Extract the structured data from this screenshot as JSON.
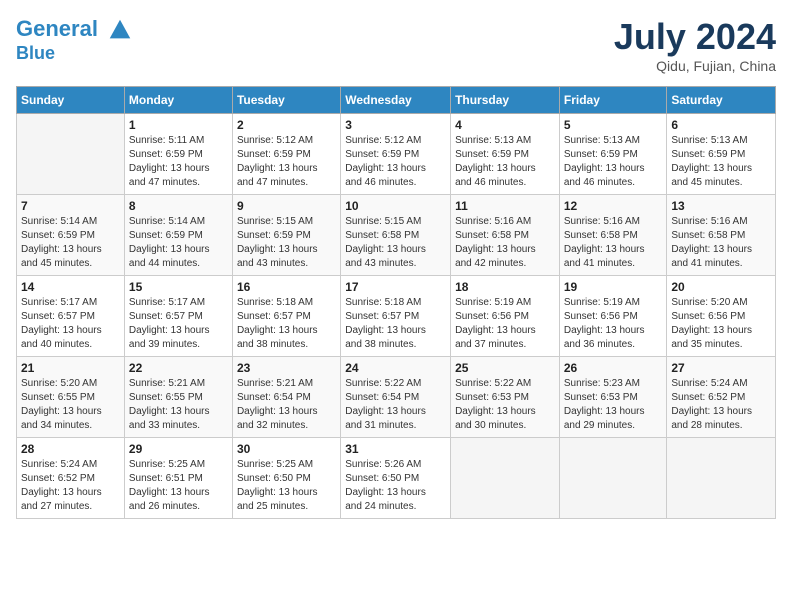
{
  "header": {
    "logo_line1": "General",
    "logo_line2": "Blue",
    "month_title": "July 2024",
    "subtitle": "Qidu, Fujian, China"
  },
  "days_of_week": [
    "Sunday",
    "Monday",
    "Tuesday",
    "Wednesday",
    "Thursday",
    "Friday",
    "Saturday"
  ],
  "weeks": [
    [
      {
        "day": "",
        "info": ""
      },
      {
        "day": "1",
        "info": "Sunrise: 5:11 AM\nSunset: 6:59 PM\nDaylight: 13 hours\nand 47 minutes."
      },
      {
        "day": "2",
        "info": "Sunrise: 5:12 AM\nSunset: 6:59 PM\nDaylight: 13 hours\nand 47 minutes."
      },
      {
        "day": "3",
        "info": "Sunrise: 5:12 AM\nSunset: 6:59 PM\nDaylight: 13 hours\nand 46 minutes."
      },
      {
        "day": "4",
        "info": "Sunrise: 5:13 AM\nSunset: 6:59 PM\nDaylight: 13 hours\nand 46 minutes."
      },
      {
        "day": "5",
        "info": "Sunrise: 5:13 AM\nSunset: 6:59 PM\nDaylight: 13 hours\nand 46 minutes."
      },
      {
        "day": "6",
        "info": "Sunrise: 5:13 AM\nSunset: 6:59 PM\nDaylight: 13 hours\nand 45 minutes."
      }
    ],
    [
      {
        "day": "7",
        "info": "Sunrise: 5:14 AM\nSunset: 6:59 PM\nDaylight: 13 hours\nand 45 minutes."
      },
      {
        "day": "8",
        "info": "Sunrise: 5:14 AM\nSunset: 6:59 PM\nDaylight: 13 hours\nand 44 minutes."
      },
      {
        "day": "9",
        "info": "Sunrise: 5:15 AM\nSunset: 6:59 PM\nDaylight: 13 hours\nand 43 minutes."
      },
      {
        "day": "10",
        "info": "Sunrise: 5:15 AM\nSunset: 6:58 PM\nDaylight: 13 hours\nand 43 minutes."
      },
      {
        "day": "11",
        "info": "Sunrise: 5:16 AM\nSunset: 6:58 PM\nDaylight: 13 hours\nand 42 minutes."
      },
      {
        "day": "12",
        "info": "Sunrise: 5:16 AM\nSunset: 6:58 PM\nDaylight: 13 hours\nand 41 minutes."
      },
      {
        "day": "13",
        "info": "Sunrise: 5:16 AM\nSunset: 6:58 PM\nDaylight: 13 hours\nand 41 minutes."
      }
    ],
    [
      {
        "day": "14",
        "info": "Sunrise: 5:17 AM\nSunset: 6:57 PM\nDaylight: 13 hours\nand 40 minutes."
      },
      {
        "day": "15",
        "info": "Sunrise: 5:17 AM\nSunset: 6:57 PM\nDaylight: 13 hours\nand 39 minutes."
      },
      {
        "day": "16",
        "info": "Sunrise: 5:18 AM\nSunset: 6:57 PM\nDaylight: 13 hours\nand 38 minutes."
      },
      {
        "day": "17",
        "info": "Sunrise: 5:18 AM\nSunset: 6:57 PM\nDaylight: 13 hours\nand 38 minutes."
      },
      {
        "day": "18",
        "info": "Sunrise: 5:19 AM\nSunset: 6:56 PM\nDaylight: 13 hours\nand 37 minutes."
      },
      {
        "day": "19",
        "info": "Sunrise: 5:19 AM\nSunset: 6:56 PM\nDaylight: 13 hours\nand 36 minutes."
      },
      {
        "day": "20",
        "info": "Sunrise: 5:20 AM\nSunset: 6:56 PM\nDaylight: 13 hours\nand 35 minutes."
      }
    ],
    [
      {
        "day": "21",
        "info": "Sunrise: 5:20 AM\nSunset: 6:55 PM\nDaylight: 13 hours\nand 34 minutes."
      },
      {
        "day": "22",
        "info": "Sunrise: 5:21 AM\nSunset: 6:55 PM\nDaylight: 13 hours\nand 33 minutes."
      },
      {
        "day": "23",
        "info": "Sunrise: 5:21 AM\nSunset: 6:54 PM\nDaylight: 13 hours\nand 32 minutes."
      },
      {
        "day": "24",
        "info": "Sunrise: 5:22 AM\nSunset: 6:54 PM\nDaylight: 13 hours\nand 31 minutes."
      },
      {
        "day": "25",
        "info": "Sunrise: 5:22 AM\nSunset: 6:53 PM\nDaylight: 13 hours\nand 30 minutes."
      },
      {
        "day": "26",
        "info": "Sunrise: 5:23 AM\nSunset: 6:53 PM\nDaylight: 13 hours\nand 29 minutes."
      },
      {
        "day": "27",
        "info": "Sunrise: 5:24 AM\nSunset: 6:52 PM\nDaylight: 13 hours\nand 28 minutes."
      }
    ],
    [
      {
        "day": "28",
        "info": "Sunrise: 5:24 AM\nSunset: 6:52 PM\nDaylight: 13 hours\nand 27 minutes."
      },
      {
        "day": "29",
        "info": "Sunrise: 5:25 AM\nSunset: 6:51 PM\nDaylight: 13 hours\nand 26 minutes."
      },
      {
        "day": "30",
        "info": "Sunrise: 5:25 AM\nSunset: 6:50 PM\nDaylight: 13 hours\nand 25 minutes."
      },
      {
        "day": "31",
        "info": "Sunrise: 5:26 AM\nSunset: 6:50 PM\nDaylight: 13 hours\nand 24 minutes."
      },
      {
        "day": "",
        "info": ""
      },
      {
        "day": "",
        "info": ""
      },
      {
        "day": "",
        "info": ""
      }
    ]
  ]
}
